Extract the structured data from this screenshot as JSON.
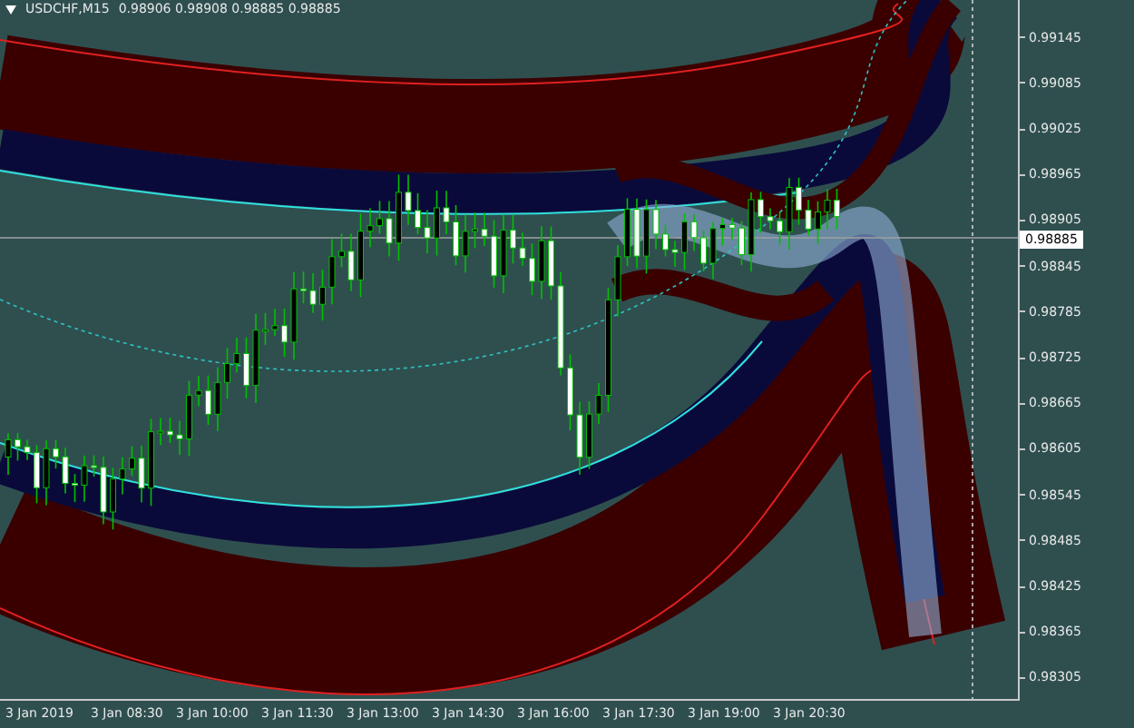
{
  "header": {
    "symbol": "USDCHF,M15",
    "quote": "0.98906 0.98908 0.98885 0.98885"
  },
  "price_axis": [
    "0.99145",
    "0.99085",
    "0.99025",
    "0.98965",
    "0.98905",
    "0.98845",
    "0.98785",
    "0.98725",
    "0.98665",
    "0.98605",
    "0.98545",
    "0.98485",
    "0.98425",
    "0.98365",
    "0.98305"
  ],
  "current_price": "0.98885",
  "time_axis": [
    "3 Jan 2019",
    "3 Jan 08:30",
    "3 Jan 10:00",
    "3 Jan 11:30",
    "3 Jan 13:00",
    "3 Jan 14:30",
    "3 Jan 16:00",
    "3 Jan 17:30",
    "3 Jan 19:00",
    "3 Jan 20:30"
  ]
}
